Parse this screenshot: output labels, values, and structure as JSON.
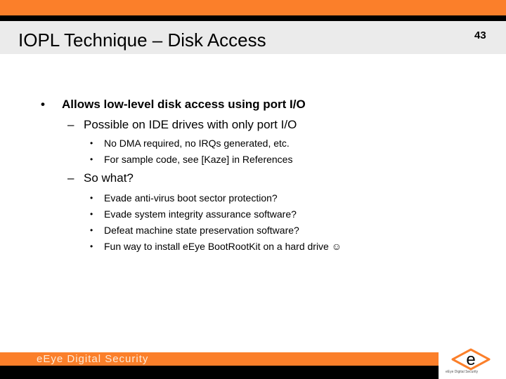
{
  "slide": {
    "title": "IOPL Technique – Disk Access",
    "number": "43"
  },
  "bullets": {
    "b1": "Allows low-level disk access using port I/O",
    "b1_1": "Possible on IDE drives with only port I/O",
    "b1_1_1": "No DMA required, no IRQs generated, etc.",
    "b1_1_2": "For sample code, see [Kaze] in References",
    "b1_2": "So what?",
    "b1_2_1": "Evade anti-virus boot sector protection?",
    "b1_2_2": "Evade system integrity assurance software?",
    "b1_2_3": "Defeat machine state preservation software?",
    "b1_2_4": "Fun way to install eEye BootRootKit on a hard drive ☺"
  },
  "glyphs": {
    "bullet_l1": "•",
    "dash_l2": "–",
    "bullet_l3": "•",
    "logo_letter": "e"
  },
  "footer": {
    "brand": "eEye Digital Security",
    "logo_caption": "eEye Digital Security"
  },
  "colors": {
    "accent_orange": "#fb7f2a",
    "title_band": "#ebebeb"
  }
}
